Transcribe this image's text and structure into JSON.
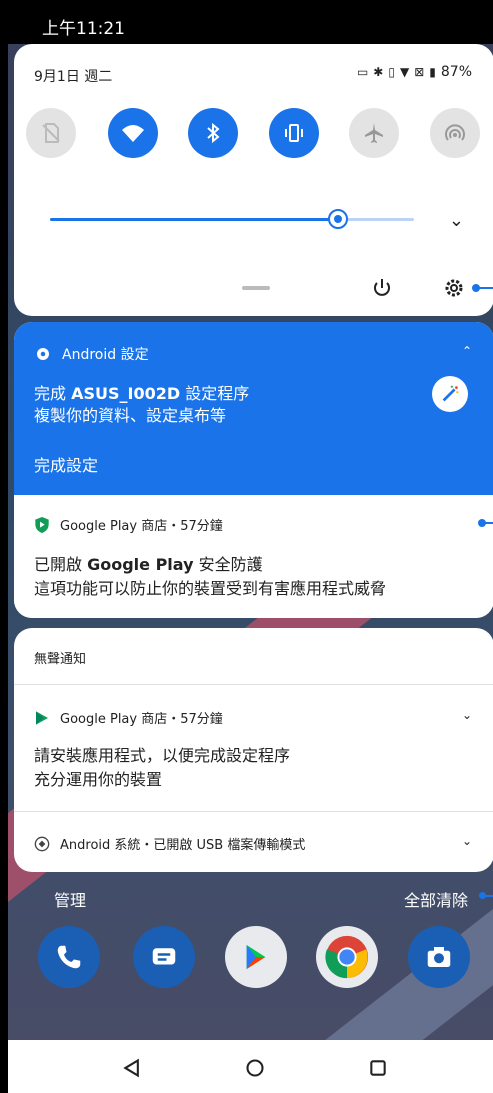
{
  "status_bar": {
    "time": "上午11:21"
  },
  "quick_settings": {
    "date": "9月1日 週二",
    "battery": "87%",
    "tiles": [
      {
        "name": "sim-tile",
        "icon": "no-sim-icon",
        "state": "off"
      },
      {
        "name": "wifi-tile",
        "icon": "wifi-icon",
        "state": "on"
      },
      {
        "name": "bluetooth-tile",
        "icon": "bluetooth-icon",
        "state": "on"
      },
      {
        "name": "vibrate-tile",
        "icon": "vibrate-icon",
        "state": "on"
      },
      {
        "name": "airplane-tile",
        "icon": "airplane-icon",
        "state": "off"
      },
      {
        "name": "hotspot-tile",
        "icon": "hotspot-icon",
        "state": "off"
      }
    ],
    "brightness_level": 0.79
  },
  "notifications": {
    "android_setup": {
      "app": "Android 設定",
      "title_prefix": "完成 ",
      "title_bold": "ASUS_I002D",
      "title_suffix": " 設定程序",
      "body": "複製你的資料、設定桌布等",
      "action": "完成設定"
    },
    "play_protect": {
      "app": "Google Play 商店・57分鐘",
      "title_prefix": "已開啟 ",
      "title_bold": "Google Play",
      "title_suffix": " 安全防護",
      "body": "這項功能可以防止你的裝置受到有害應用程式威脅"
    },
    "silent_header": "無聲通知",
    "play_setup": {
      "app": "Google Play 商店・57分鐘",
      "line1": "請安裝應用程式，以便完成設定程序",
      "line2": "充分運用你的裝置"
    },
    "usb": {
      "app": "Android 系統・已開啟 USB 檔案傳輸模式"
    }
  },
  "footer": {
    "manage": "管理",
    "clear_all": "全部清除"
  },
  "colors": {
    "accent": "#1a73e8",
    "tile_off": "#e3e3e3"
  }
}
